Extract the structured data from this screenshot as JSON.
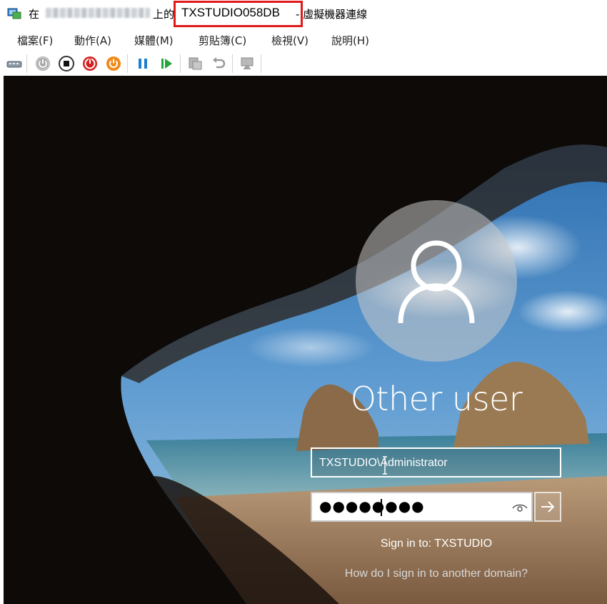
{
  "titlebar": {
    "prefix": "在",
    "on": "上的",
    "vm_name": "TXSTUDIO058DB",
    "suffix": "- 虛擬機器連線",
    "icon": "vm-connection-icon",
    "highlight_color": "#e01b1b"
  },
  "menu": [
    {
      "label": "檔案(F)"
    },
    {
      "label": "動作(A)"
    },
    {
      "label": "媒體(M)"
    },
    {
      "label": "剪貼簿(C)"
    },
    {
      "label": "檢視(V)"
    },
    {
      "label": "說明(H)"
    }
  ],
  "toolbar": [
    {
      "icon": "ctrl-alt-del-icon"
    },
    {
      "icon": "start-icon"
    },
    {
      "icon": "turn-off-icon"
    },
    {
      "icon": "shutdown-icon"
    },
    {
      "icon": "power-icon"
    },
    {
      "icon": "pause-icon"
    },
    {
      "icon": "resume-icon"
    },
    {
      "icon": "checkpoint-icon"
    },
    {
      "icon": "revert-icon"
    },
    {
      "icon": "enhanced-session-icon"
    }
  ],
  "login": {
    "user_title": "Other user",
    "username_value": "TXSTUDIO\\Administrator",
    "password_mask": "●●●●●●●●",
    "signin_to": "Sign in to: TXSTUDIO",
    "other_domain_link": "How do I sign in to another domain?"
  }
}
